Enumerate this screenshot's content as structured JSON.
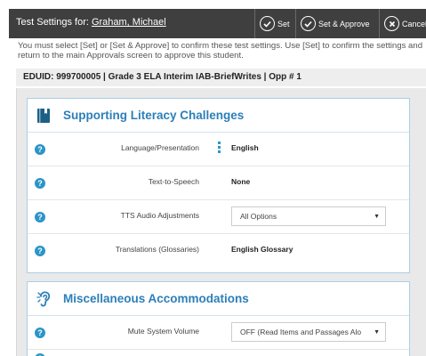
{
  "header": {
    "title_prefix": "Test Settings for:",
    "student_name": "Graham, Michael",
    "buttons": [
      {
        "label": "Set",
        "icon": "check-circle-icon"
      },
      {
        "label": "Set & Approve",
        "icon": "check-circle-icon"
      },
      {
        "label": "Cancel",
        "icon": "x-circle-icon"
      }
    ]
  },
  "instructions": "You must select [Set] or [Set & Approve] to confirm these test settings. Use [Set] to confirm the settings and return to the main Approvals screen to approve this student.",
  "eduid_line": "EDUID: 999700005 | Grade 3 ELA Interim IAB-BriefWrites | Opp # 1",
  "sections": [
    {
      "title": "Supporting Literacy Challenges",
      "icon": "book-icon",
      "rows": [
        {
          "label": "Language/Presentation",
          "value": "English"
        },
        {
          "label": "Text-to-Speech",
          "value": "None"
        },
        {
          "label": "TTS Audio Adjustments",
          "value": "All Options"
        },
        {
          "label": "Translations (Glossaries)",
          "value": "English Glossary"
        }
      ]
    },
    {
      "title": "Miscellaneous Accommodations",
      "icon": "ear-icon",
      "rows": [
        {
          "label": "Mute System Volume",
          "value": "OFF (Read Items and Passages Alo"
        }
      ]
    }
  ],
  "colors": {
    "header_bg": "#3f3f3f",
    "accent": "#2c7fb8",
    "info_icon": "#2b95c8",
    "panel_border": "#a8cfe8"
  }
}
